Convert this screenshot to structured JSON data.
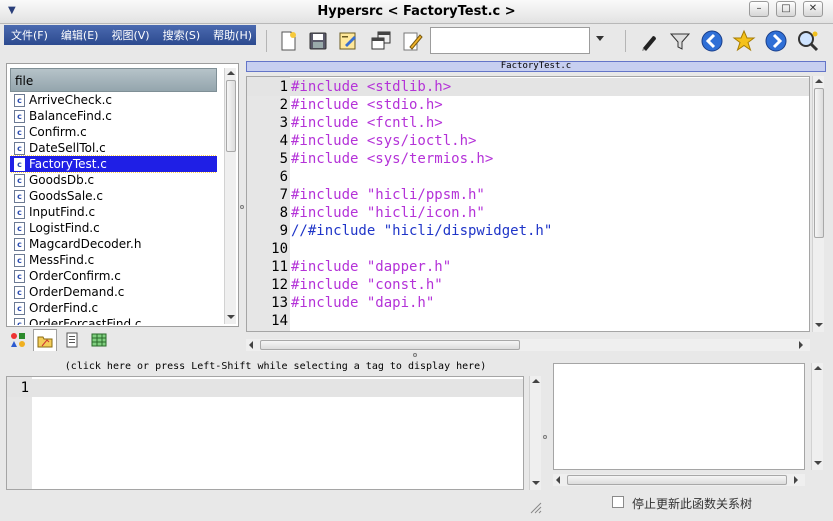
{
  "window": {
    "title": "Hypersrc < FactoryTest.c >",
    "buttons": {
      "minimize": "–",
      "maximize": "□",
      "close": "✕"
    }
  },
  "menu": {
    "items": [
      {
        "label": "文件(F)"
      },
      {
        "label": "编辑(E)"
      },
      {
        "label": "视图(V)"
      },
      {
        "label": "搜索(S)"
      },
      {
        "label": "帮助(H)"
      }
    ]
  },
  "toolbar": {
    "left_icons": [
      "new-file-icon",
      "save-icon",
      "edit-doc-icon",
      "copy-windows-icon",
      "note-pencil-icon"
    ],
    "search_value": "",
    "right_icons": [
      "pen-icon",
      "filter-icon",
      "back-arrow-icon",
      "star-icon",
      "forward-arrow-icon",
      "find-icon"
    ],
    "colors": {
      "nav_blue": "#2f6fd6",
      "star_gold": "#f5c21a"
    }
  },
  "file_panel": {
    "header": "file",
    "files": [
      "ArriveCheck.c",
      "BalanceFind.c",
      "Confirm.c",
      "DateSellTol.c",
      "FactoryTest.c",
      "GoodsDb.c",
      "GoodsSale.c",
      "InputFind.c",
      "LogistFind.c",
      "MagcardDecoder.h",
      "MessFind.c",
      "OrderConfirm.c",
      "OrderDemand.c",
      "OrderFind.c",
      "OrderForcastFind.c"
    ],
    "selected": "FactoryTest.c",
    "file_icon_letter": "c",
    "tabs": [
      "tag-view-icon",
      "file-view-icon",
      "list-view-icon",
      "table-view-icon"
    ],
    "selection_color": "#1f1fe6"
  },
  "editor": {
    "tab_label": "FactoryTest.c",
    "lines": [
      {
        "num": "1",
        "text": "#include <stdlib.h>",
        "kind": "pre"
      },
      {
        "num": "2",
        "text": "#include <stdio.h>",
        "kind": "pre"
      },
      {
        "num": "3",
        "text": "#include <fcntl.h>",
        "kind": "pre"
      },
      {
        "num": "4",
        "text": "#include <sys/ioctl.h>",
        "kind": "pre"
      },
      {
        "num": "5",
        "text": "#include <sys/termios.h>",
        "kind": "pre"
      },
      {
        "num": "6",
        "text": "",
        "kind": "pre"
      },
      {
        "num": "7",
        "text": "#include \"hicli/ppsm.h\"",
        "kind": "pre"
      },
      {
        "num": "8",
        "text": "#include \"hicli/icon.h\"",
        "kind": "pre"
      },
      {
        "num": "9",
        "text": "//#include \"hicli/dispwidget.h\"",
        "kind": "comment"
      },
      {
        "num": "10",
        "text": "",
        "kind": "pre"
      },
      {
        "num": "11",
        "text": "#include \"dapper.h\"",
        "kind": "pre"
      },
      {
        "num": "12",
        "text": "#include \"const.h\"",
        "kind": "pre"
      },
      {
        "num": "13",
        "text": "#include \"dapi.h\"",
        "kind": "pre"
      },
      {
        "num": "14",
        "text": "",
        "kind": "pre"
      }
    ],
    "colors": {
      "preprocessor": "#b432d8",
      "comment": "#1f35c8"
    }
  },
  "tag_panel": {
    "hint": "(click here or press Left-Shift while selecting a tag to display here)",
    "line_number": "1"
  },
  "relation_panel": {
    "checkbox_label": "停止更新此函数关系树",
    "checked": false
  }
}
